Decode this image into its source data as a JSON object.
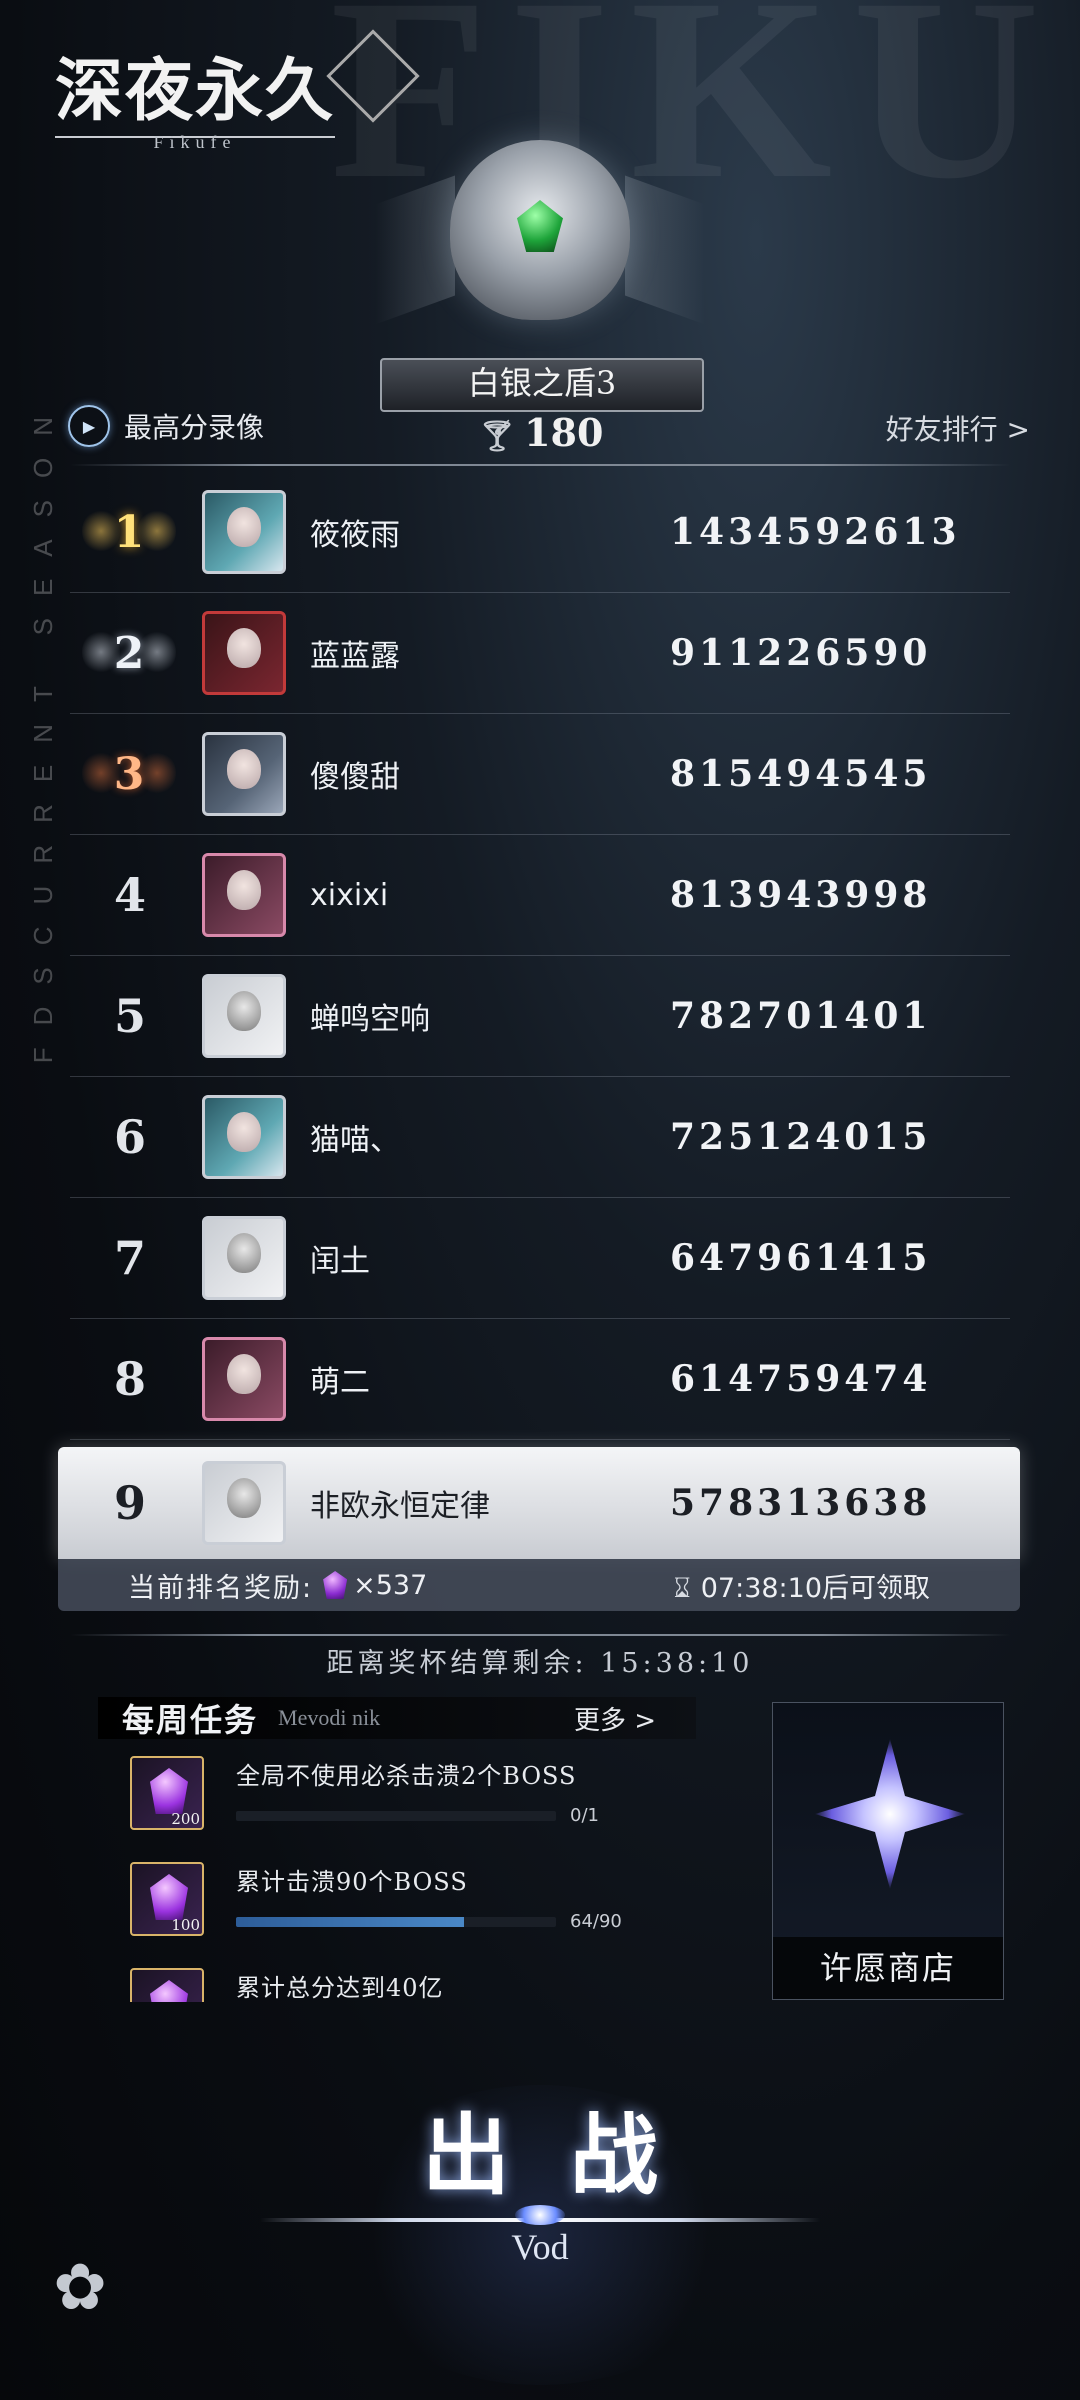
{
  "header": {
    "game_title": "深夜永久",
    "game_subtitle": "Fikufe",
    "bg_letters": "FIKU",
    "side_text": "FDSCURRENT SEASON"
  },
  "rank_tier": {
    "name": "白银之盾3",
    "trophies": "180"
  },
  "actions": {
    "replay_label": "最高分录像",
    "friends_label": "好友排行 >"
  },
  "leaderboard": [
    {
      "rank": "1",
      "medal": "gold",
      "name": "筱筱雨",
      "score": "1434592613"
    },
    {
      "rank": "2",
      "medal": "silver",
      "name": "蓝蓝露",
      "score": "911226590"
    },
    {
      "rank": "3",
      "medal": "bronze",
      "name": "傻傻甜",
      "score": "815494545"
    },
    {
      "rank": "4",
      "name": "xixixi",
      "score": "813943998"
    },
    {
      "rank": "5",
      "name": "蝉鸣空响",
      "score": "782701401"
    },
    {
      "rank": "6",
      "name": "猫喵、",
      "score": "725124015"
    },
    {
      "rank": "7",
      "name": "闰土",
      "score": "647961415"
    },
    {
      "rank": "8",
      "name": "萌二",
      "score": "614759474"
    }
  ],
  "my_entry": {
    "rank": "9",
    "name": "非欧永恒定律",
    "score": "578313638"
  },
  "reward": {
    "label": "当前排名奖励:",
    "amount": "×537",
    "timer": "07:38:10后可领取"
  },
  "settlement": {
    "text": "距离奖杯结算剩余:  15:38:10"
  },
  "tasks": {
    "title": "每周任务",
    "subtitle": "Mevodi nik",
    "more": "更多 >",
    "items": [
      {
        "desc": "全局不使用必杀击溃2个BOSS",
        "reward": "200",
        "progress_text": "0/1",
        "progress": 0.0
      },
      {
        "desc": "累计击溃90个BOSS",
        "reward": "100",
        "progress_text": "64/90",
        "progress": 0.711
      },
      {
        "desc": "累计总分达到40亿"
      }
    ]
  },
  "wish_shop": {
    "label": "许愿商店"
  },
  "battle": {
    "label": "出战",
    "sub": "Vod"
  },
  "colors": {
    "accent_gold": "#d9b469",
    "gem_purple": "#9b33e0",
    "progress_blue": "#4a88c7"
  }
}
